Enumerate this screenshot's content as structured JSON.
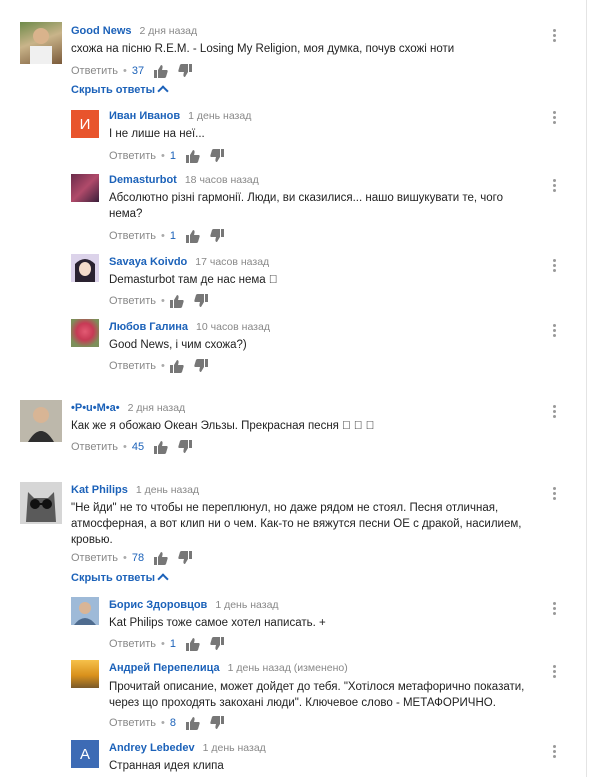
{
  "c1": {
    "author": "Good News",
    "time": "2 дня назад",
    "text": "схожа на пісню  R.E.M. - Losing My Religion, моя думка, почув схожі ноти",
    "reply": "Ответить",
    "likes": "37",
    "toggle": "Скрыть ответы"
  },
  "r1": {
    "author": "Иван Иванов",
    "time": "1 день назад",
    "text": "І не лише на неї...",
    "reply": "Ответить",
    "likes": "1",
    "avatar_letter": "И",
    "avatar_color": "#e8542c"
  },
  "r2": {
    "author": "Demasturbot",
    "time": "18 часов назад",
    "text": "Абсолютно різні гармонії. Люди, ви сказилися... нашо вишукувати те, чого нема?",
    "reply": "Ответить",
    "likes": "1"
  },
  "r3": {
    "author": "Savaya Koivdo",
    "time": "17 часов назад",
    "text": "Demasturbot там де нас нема ￿",
    "reply": "Ответить"
  },
  "r4": {
    "author": "Любов Галина",
    "time": "10 часов назад",
    "text": "Good News, і чим схожа?)",
    "reply": "Ответить"
  },
  "c2": {
    "author": "•P•u•M•a•",
    "time": "2 дня назад",
    "text": "Как же я обожаю Океан Эльзы. Прекрасная песня ￿ ￿ ￿",
    "reply": "Ответить",
    "likes": "45"
  },
  "c3": {
    "author": "Kat Philips",
    "time": "1 день назад",
    "text": "\"Не йди\" не то чтобы не переплюнул, но даже рядом не стоял. Песня отличная, атмосферная, а вот клип ни о чем. Как-то не вяжутся песни ОЕ с дракой, насилием, кровью.",
    "reply": "Ответить",
    "likes": "78",
    "toggle": "Скрыть ответы"
  },
  "r5": {
    "author": "Борис Здоровцов",
    "time": "1 день назад",
    "text": "Kat Philips тоже самое хотел написать. +",
    "reply": "Ответить",
    "likes": "1"
  },
  "r6": {
    "author": "Андрей Перепелица",
    "time": "1 день назад (изменено)",
    "text": "Прочитай описание, может дойдет до тебя. \"Хотілося метафорично показати, через що проходять закохані люди\". Ключевое слово - МЕТАФОРИЧНО.",
    "reply": "Ответить",
    "likes": "8"
  },
  "r7": {
    "author": "Andrey Lebedev",
    "time": "1 день назад",
    "text": "Странная идея клипа",
    "avatar_letter": "A",
    "avatar_color": "#3d6bb5"
  }
}
